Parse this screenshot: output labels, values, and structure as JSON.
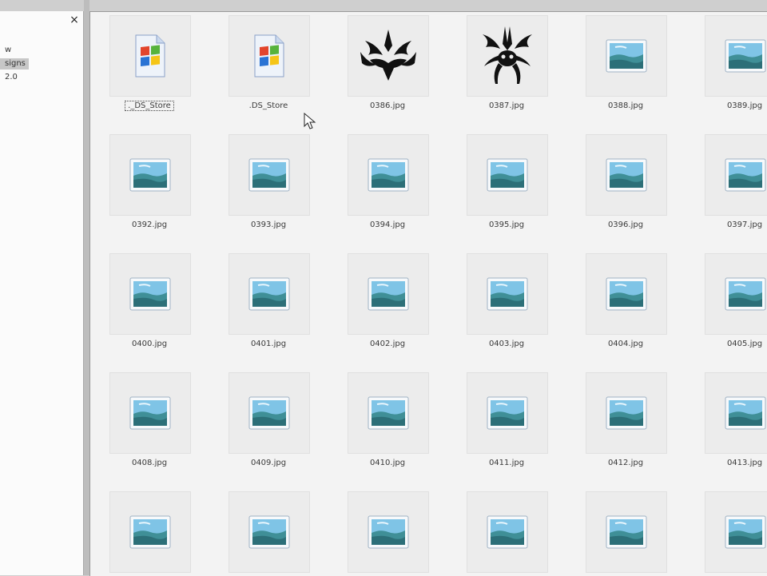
{
  "sidebar": {
    "close_label": "×",
    "items": [
      {
        "label": "w",
        "selected": false
      },
      {
        "label": "signs",
        "selected": true
      },
      {
        "label": "2.0",
        "selected": false
      }
    ]
  },
  "files": [
    {
      "name": "._DS_Store",
      "icon": "ds-store-icon",
      "focused": true
    },
    {
      "name": ".DS_Store",
      "icon": "ds-store-icon"
    },
    {
      "name": "0386.jpg",
      "icon": "tribal-tattoo-thumbnail"
    },
    {
      "name": "0387.jpg",
      "icon": "tribal-spider-thumbnail"
    },
    {
      "name": "0388.jpg",
      "icon": "image-icon"
    },
    {
      "name": "0389.jpg",
      "icon": "image-icon"
    },
    {
      "name": "0392.jpg",
      "icon": "image-icon"
    },
    {
      "name": "0393.jpg",
      "icon": "image-icon"
    },
    {
      "name": "0394.jpg",
      "icon": "image-icon"
    },
    {
      "name": "0395.jpg",
      "icon": "image-icon"
    },
    {
      "name": "0396.jpg",
      "icon": "image-icon"
    },
    {
      "name": "0397.jpg",
      "icon": "image-icon"
    },
    {
      "name": "0400.jpg",
      "icon": "image-icon"
    },
    {
      "name": "0401.jpg",
      "icon": "image-icon"
    },
    {
      "name": "0402.jpg",
      "icon": "image-icon"
    },
    {
      "name": "0403.jpg",
      "icon": "image-icon"
    },
    {
      "name": "0404.jpg",
      "icon": "image-icon"
    },
    {
      "name": "0405.jpg",
      "icon": "image-icon"
    },
    {
      "name": "0408.jpg",
      "icon": "image-icon"
    },
    {
      "name": "0409.jpg",
      "icon": "image-icon"
    },
    {
      "name": "0410.jpg",
      "icon": "image-icon"
    },
    {
      "name": "0411.jpg",
      "icon": "image-icon"
    },
    {
      "name": "0412.jpg",
      "icon": "image-icon"
    },
    {
      "name": "0413.jpg",
      "icon": "image-icon"
    },
    {
      "name": "",
      "icon": "image-icon"
    },
    {
      "name": "",
      "icon": "image-icon"
    },
    {
      "name": "",
      "icon": "image-icon"
    },
    {
      "name": "",
      "icon": "image-icon"
    },
    {
      "name": "",
      "icon": "image-icon"
    },
    {
      "name": "",
      "icon": "image-icon"
    }
  ],
  "colors": {
    "sky": "#7fc4e6",
    "sea": "#3f8f97",
    "frame": "#9fb2c4"
  }
}
